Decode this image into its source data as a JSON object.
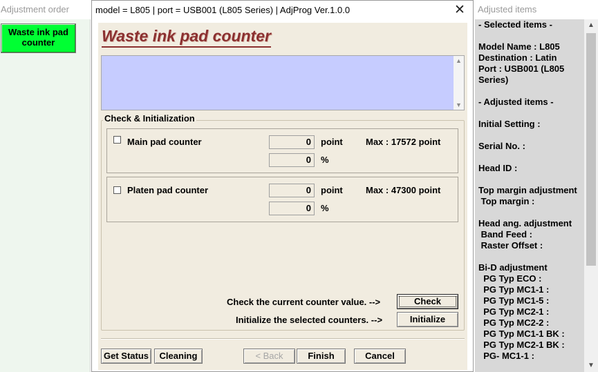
{
  "left_panel": {
    "title": "Adjustment order",
    "button_line1": "Waste ink pad",
    "button_line2": "counter"
  },
  "dialog": {
    "title": "model = L805 | port = USB001 (L805 Series) | AdjProg Ver.1.0.0",
    "close_glyph": "✕",
    "heading": "Waste ink pad counter",
    "group_label": "Check & Initialization",
    "counters": [
      {
        "label": "Main pad counter",
        "point_value": "0",
        "point_unit": "point",
        "percent_value": "0",
        "percent_unit": "%",
        "max": "Max : 17572 point"
      },
      {
        "label": "Platen pad counter",
        "point_value": "0",
        "point_unit": "point",
        "percent_value": "0",
        "percent_unit": "%",
        "max": "Max : 47300 point"
      }
    ],
    "check_prompt": "Check the current counter value. -->",
    "check_button": "Check",
    "init_prompt": "Initialize the selected counters. -->",
    "init_button": "Initialize",
    "bottom_buttons": {
      "get_status": "Get Status",
      "cleaning": "Cleaning",
      "back": "< Back",
      "finish": "Finish",
      "cancel": "Cancel"
    }
  },
  "right_panel": {
    "title": "Adjusted items",
    "lines": [
      "- Selected items -",
      "",
      "Model Name : L805",
      "Destination : Latin",
      "Port : USB001 (L805",
      "Series)",
      "",
      "- Adjusted items -",
      "",
      "Initial Setting :",
      "",
      "Serial No. :",
      "",
      "Head ID :",
      "",
      "Top margin adjustment",
      " Top margin :",
      "",
      "Head ang. adjustment",
      " Band Feed :",
      " Raster Offset :",
      "",
      "Bi-D adjustment",
      "  PG Typ ECO :",
      "  PG Typ MC1-1 :",
      "  PG Typ MC1-5 :",
      "  PG Typ MC2-1 :",
      "  PG Typ MC2-2 :",
      "  PG Typ MC1-1 BK :",
      "  PG Typ MC2-1 BK :",
      "  PG- MC1-1 :"
    ]
  }
}
